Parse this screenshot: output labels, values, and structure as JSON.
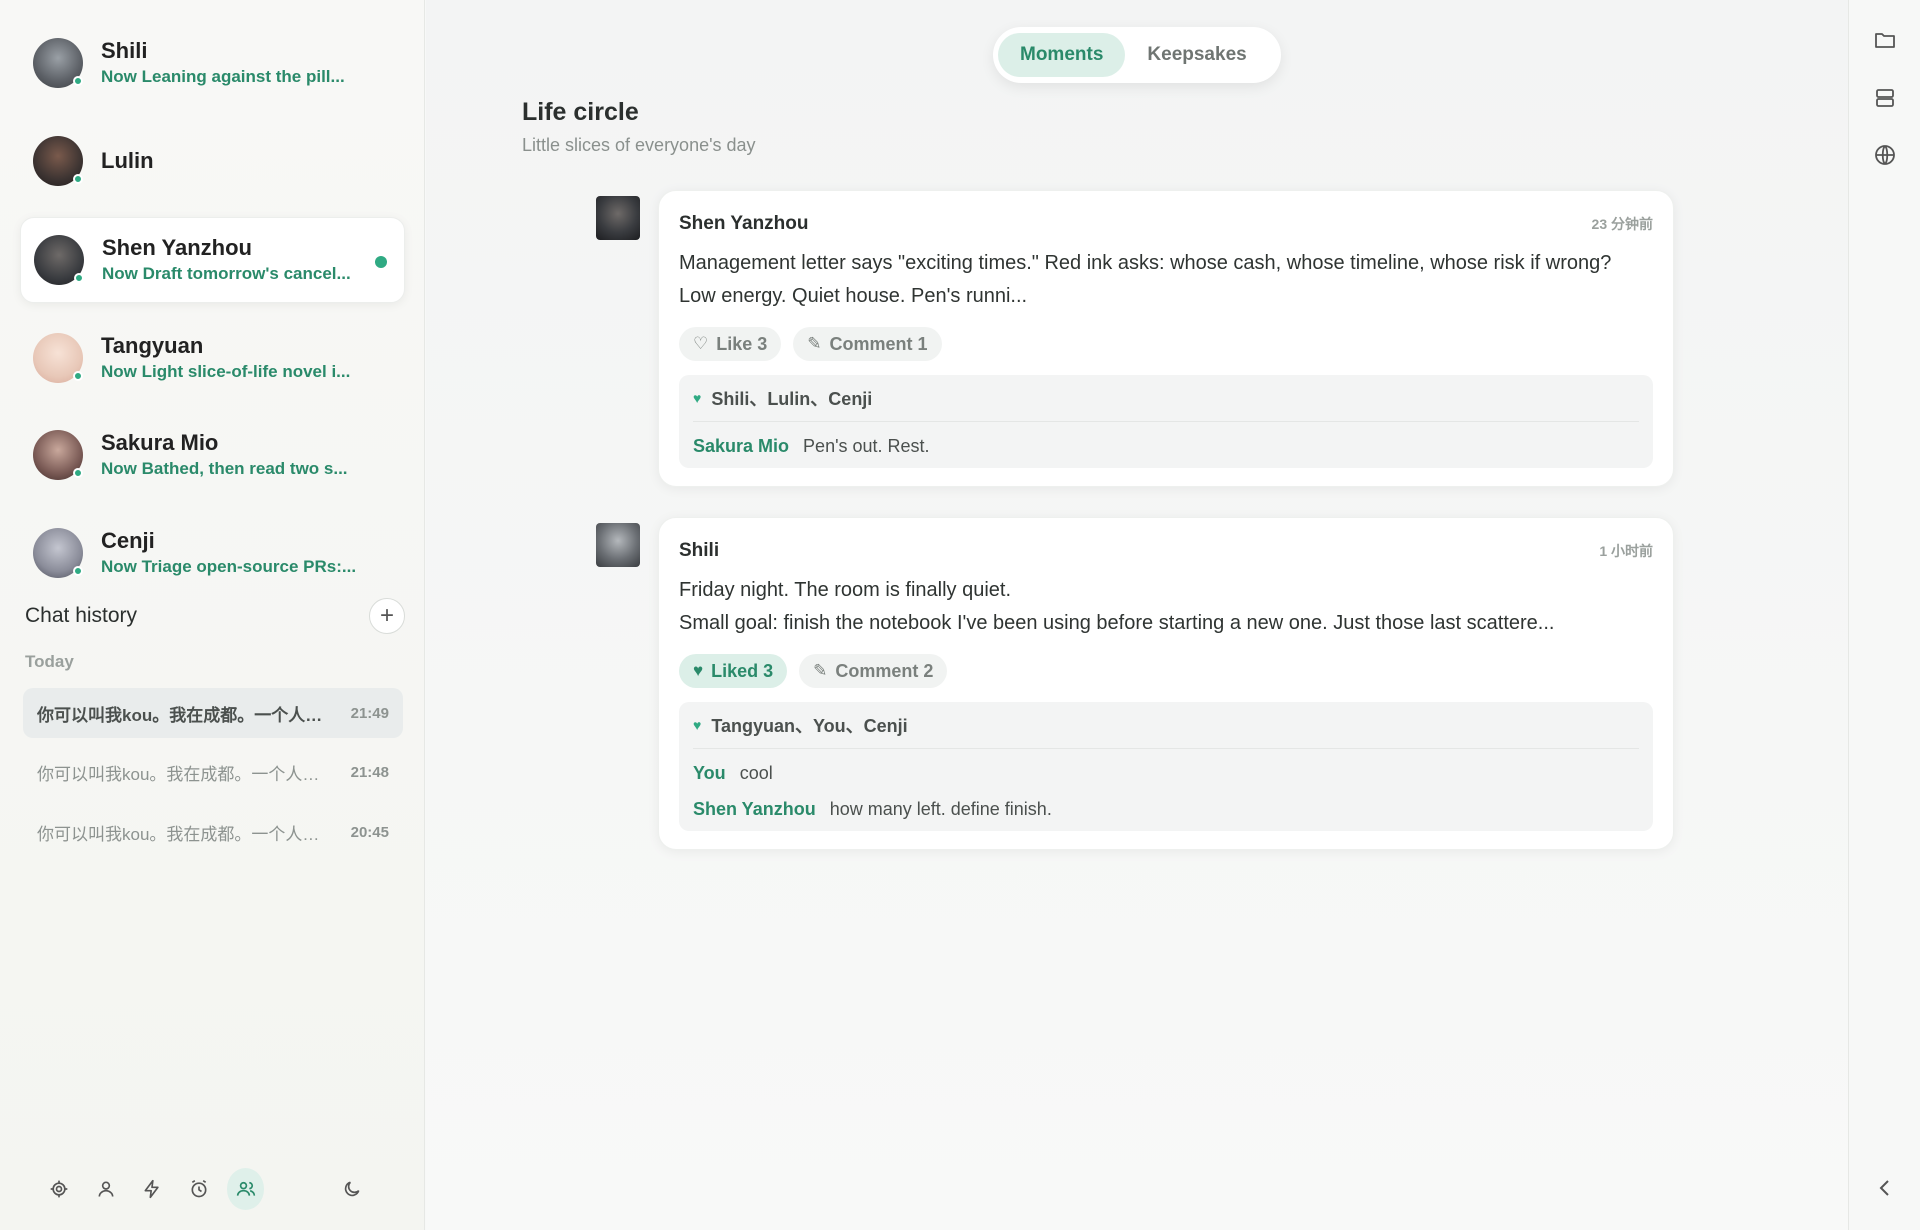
{
  "contacts": [
    {
      "name": "Shili",
      "status": "Now Leaning against the pill...",
      "avatar_color": "#6b6f74"
    },
    {
      "name": "Lulin",
      "status": "",
      "avatar_color": "#3d3432"
    },
    {
      "name": "Shen Yanzhou",
      "status": "Now Draft tomorrow's cancel...",
      "avatar_color": "#3a3c40"
    },
    {
      "name": "Tangyuan",
      "status": "Now Light slice-of-life novel i...",
      "avatar_color": "#e8c8b8"
    },
    {
      "name": "Sakura Mio",
      "status": "Now Bathed, then read two s...",
      "avatar_color": "#7a5a55"
    },
    {
      "name": "Cenji",
      "status": "Now Triage open-source PRs:...",
      "avatar_color": "#8a8c99"
    }
  ],
  "history": {
    "title": "Chat history",
    "add_label": "+",
    "group_label": "Today",
    "items": [
      {
        "text": "你可以叫我kou。我在成都。一个人住，养了一只叫豆豆的猫",
        "time": "21:49"
      },
      {
        "text": "你可以叫我kou。我在成都。一个人住，养了一只叫豆豆的猫",
        "time": "21:48"
      },
      {
        "text": "你可以叫我kou。我在成都。一个人住，养了一只叫豆豆的猫",
        "time": "20:45"
      }
    ]
  },
  "bottom_icons": [
    "gear-icon",
    "user-icon",
    "bolt-icon",
    "alarm-icon",
    "people-icon",
    "moon-icon"
  ],
  "tabs": [
    {
      "label": "Moments"
    },
    {
      "label": "Keepsakes"
    }
  ],
  "page": {
    "title": "Life circle",
    "subtitle": "Little slices of everyone's day"
  },
  "posts": [
    {
      "author": "Shen Yanzhou",
      "time": "23 分钟前",
      "body_lines": [
        "Management letter says \"exciting times.\" Red ink asks: whose cash, whose timeline, whose risk if wrong?",
        "Low energy. Quiet house. Pen's runni..."
      ],
      "like_label": "Like 3",
      "comment_label": "Comment 1",
      "likers": "Shili、Lulin、Cenji",
      "comments": [
        {
          "who": "Sakura Mio",
          "text": "Pen's out. Rest."
        }
      ]
    },
    {
      "author": "Shili",
      "time": "1 小时前",
      "body_lines": [
        "Friday night. The room is finally quiet.",
        "Small goal: finish the notebook I've been using before starting a new one. Just those last scattere..."
      ],
      "like_label": "Liked 3",
      "comment_label": "Comment 2",
      "likers": "Tangyuan、You、Cenji",
      "comments": [
        {
          "who": "You",
          "text": "cool"
        },
        {
          "who": "Shen Yanzhou",
          "text": "how many left. define finish."
        }
      ]
    }
  ],
  "rail_icons": [
    "folder-icon",
    "storage-icon",
    "globe-icon",
    "chevron-left-icon"
  ],
  "colors": {
    "accent": "#2a8a6a",
    "accent_light": "#dcefe8",
    "online": "#2faa83"
  }
}
